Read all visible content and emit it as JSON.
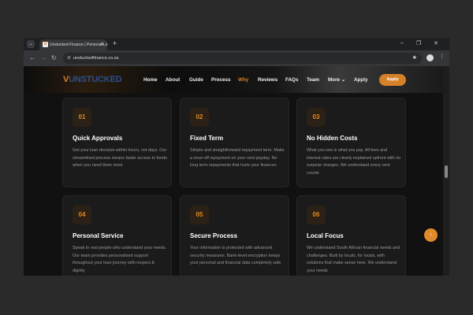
{
  "browser": {
    "tab_title": "Unstucked Finance | Personal Lo",
    "url": "unstuckedfinance.co.za"
  },
  "nav": {
    "logo": "UNSTUCKED",
    "logo_mark": "V",
    "links": [
      "Home",
      "About",
      "Guide",
      "Process",
      "Why",
      "Reviews",
      "FAQs",
      "Team",
      "More",
      "Apply"
    ],
    "active": "Why",
    "cta": "Apply"
  },
  "colors": {
    "accent": "#d4812a",
    "background": "#111111",
    "card": "#1b1b1b"
  },
  "cards": [
    {
      "num": "01",
      "title": "Quick Approvals",
      "desc": "Get your loan decision within hours, not days. Our streamlined process means faster access to funds when you need them most"
    },
    {
      "num": "02",
      "title": "Fixed Term",
      "desc": "Simple and straightforward repayment term. Make a once-off repayment on your next payday. No long term repayments that hurts your finances"
    },
    {
      "num": "03",
      "title": "No Hidden Costs",
      "desc": "What you see is what you pay. All fees and interest rates are clearly explained upfront with no surprise charges. We understand every cent counts"
    },
    {
      "num": "04",
      "title": "Personal Service",
      "desc": "Speak to real people who understand your needs. Our team provides personalized support throughout your loan journey with respect & dignity"
    },
    {
      "num": "05",
      "title": "Secure Process",
      "desc": "Your information is protected with advanced security measures. Bank-level encryption keeps your personal and financial data completely safe"
    },
    {
      "num": "06",
      "title": "Local Focus",
      "desc": "We understand South African financial needs and challenges. Built by locals, for locals, with solutions that make sense here. We understand your needs"
    }
  ]
}
